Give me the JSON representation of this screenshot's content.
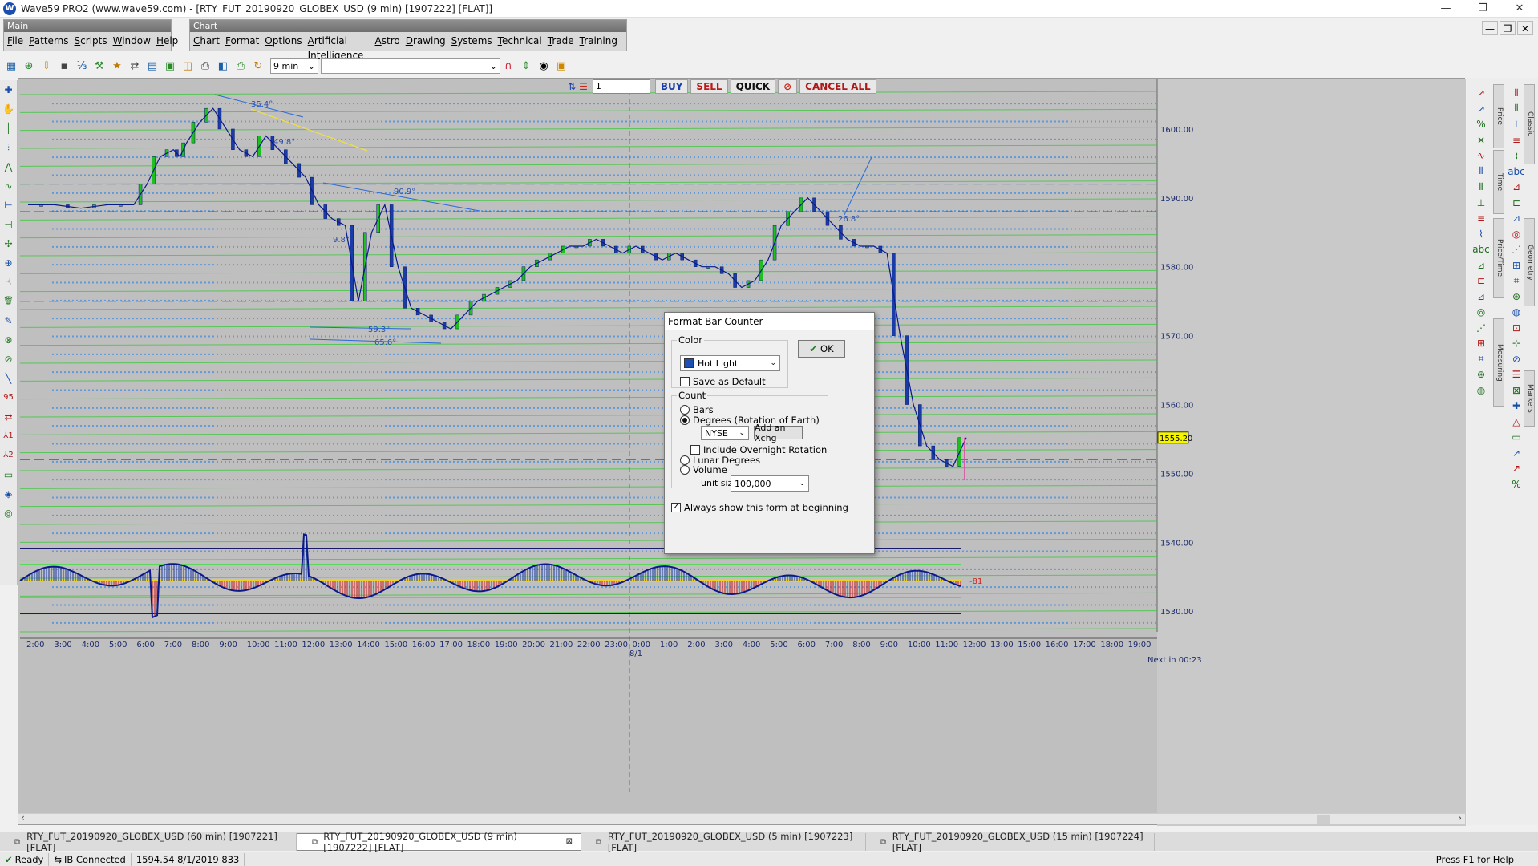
{
  "window": {
    "title": "Wave59 PRO2 (www.wave59.com) - [RTY_FUT_20190920_GLOBEX_USD (9 min) [1907222] [FLAT]]",
    "logo": "W",
    "min": "—",
    "restore": "❐",
    "close": "✕"
  },
  "menus": {
    "main": {
      "label": "Main",
      "items": [
        "File",
        "Patterns",
        "Scripts",
        "Window",
        "Help"
      ]
    },
    "chart": {
      "label": "Chart",
      "items": [
        "Chart",
        "Format",
        "Options",
        "Artificial Intelligence",
        "Astro",
        "Drawing",
        "Systems",
        "Technical",
        "Trade",
        "Training"
      ]
    }
  },
  "toolbar": {
    "interval": "9 min",
    "symbol": "",
    "icons": [
      "chart-open-icon",
      "zoom-icon",
      "import-icon",
      "camera-icon",
      "counter-icon",
      "hammer-icon",
      "star-icon",
      "exchange-icon",
      "folder-icon",
      "save-icon",
      "print-preview-icon",
      "print-icon",
      "scan-icon",
      "printer-icon",
      "refresh-icon"
    ]
  },
  "tradebar": {
    "qty": "1",
    "buy": "BUY",
    "sell": "SELL",
    "quick": "QUICK",
    "cancel_all": "CANCEL ALL"
  },
  "mdi": {
    "min": "—",
    "restore": "❐",
    "close": "✕"
  },
  "chart_data": {
    "type": "line",
    "price_axis": {
      "ticks": [
        "1600.00",
        "1590.00",
        "1580.00",
        "1570.00",
        "1560.00",
        "1550.00",
        "1540.00",
        "1530.00"
      ],
      "ylim": [
        1527,
        1605
      ],
      "current_price": "1555.20"
    },
    "time_axis": {
      "labels": [
        "2:00",
        "3:00",
        "4:00",
        "5:00",
        "6:00",
        "7:00",
        "8:00",
        "9:00",
        "10:00",
        "11:00",
        "12:00",
        "13:00",
        "14:00",
        "15:00",
        "16:00",
        "17:00",
        "18:00",
        "19:00",
        "20:00",
        "21:00",
        "22:00",
        "23:00",
        "0:00",
        "1:00",
        "2:00",
        "3:00",
        "4:00",
        "5:00",
        "6:00",
        "7:00",
        "8:00",
        "9:00",
        "10:00",
        "11:00",
        "12:00",
        "13:00",
        "15:00",
        "16:00",
        "17:00",
        "18:00",
        "19:00"
      ],
      "date_marker": "8/1"
    },
    "price_series": {
      "x": [
        0,
        2,
        4,
        6,
        8,
        9,
        10,
        11,
        11.5,
        12,
        13,
        14,
        15,
        16,
        17,
        18,
        19,
        20,
        21,
        22,
        23,
        24,
        25,
        26,
        27,
        28,
        29,
        30,
        31,
        32,
        33,
        34,
        35,
        36,
        37,
        38,
        39,
        40,
        41,
        42,
        43,
        44,
        45,
        46,
        47,
        48,
        49,
        50,
        51,
        52,
        53,
        54,
        55,
        56,
        57,
        58,
        59,
        60,
        61,
        62,
        63,
        64,
        65,
        66,
        67,
        68,
        69,
        70,
        71
      ],
      "y": [
        1589,
        1589,
        1588.5,
        1589,
        1589,
        1592,
        1596,
        1597,
        1596,
        1598,
        1601,
        1603,
        1600,
        1597,
        1596,
        1599,
        1597,
        1595,
        1593,
        1589,
        1587,
        1586,
        1575,
        1585,
        1589,
        1580,
        1574,
        1573,
        1572,
        1571,
        1573,
        1575,
        1576,
        1577,
        1578,
        1580,
        1581,
        1582,
        1583,
        1583,
        1584,
        1583,
        1582,
        1583,
        1582,
        1581,
        1582,
        1581,
        1580,
        1580,
        1579,
        1577,
        1578,
        1581,
        1586,
        1588,
        1590,
        1588,
        1586,
        1584,
        1583,
        1583,
        1582,
        1570,
        1560,
        1554,
        1552,
        1551,
        1555.2
      ]
    },
    "annotations": [
      "35.4°",
      "49.8°",
      "90.9°",
      "9.8°",
      "59.3°",
      "65.6°",
      "26.8°"
    ],
    "oscillator": {
      "label": "-81"
    },
    "footer_text": "Next in 00:23"
  },
  "dialog": {
    "title": "Format Bar Counter",
    "ok": "OK",
    "color_group": "Color",
    "color_value": "Hot Light",
    "save_default": "Save as Default",
    "count_group": "Count",
    "opt_bars": "Bars",
    "opt_degrees": "Degrees (Rotation of Earth)",
    "exchange": "NYSE",
    "add_xchg": "Add an Xchg",
    "include_overnight": "Include Overnight Rotation",
    "opt_lunar": "Lunar Degrees",
    "opt_volume": "Volume",
    "unit_size_label": "unit size:",
    "unit_size_value": "100,000",
    "always_show": "Always show this form at beginning",
    "swatch_color": "#1e4fb5"
  },
  "left_tools": [
    "✚",
    "✋",
    "│",
    "⫶",
    "⋀",
    "∿",
    "⊢",
    "⊣",
    "✢",
    "⊕",
    "☝",
    "🗑",
    "✎",
    "⊗",
    "⊘",
    "╲",
    "95",
    "⇄",
    "⅄1",
    "⅄2",
    "▭",
    "◈",
    "◎"
  ],
  "right_panel_tabs": [
    "Price",
    "Time",
    "Price/Time",
    "Measuring",
    "Classic",
    "Geometry",
    "Markers"
  ],
  "tabs": [
    {
      "label": "RTY_FUT_20190920_GLOBEX_USD (60 min) [1907221] [FLAT]",
      "active": false
    },
    {
      "label": "RTY_FUT_20190920_GLOBEX_USD (9 min) [1907222] [FLAT]",
      "active": true
    },
    {
      "label": "RTY_FUT_20190920_GLOBEX_USD (5 min) [1907223] [FLAT]",
      "active": false
    },
    {
      "label": "RTY_FUT_20190920_GLOBEX_USD (15 min) [1907224] [FLAT]",
      "active": false
    }
  ],
  "status": {
    "ready": "Ready",
    "ib": "IB Connected",
    "readout": "1594.54  8/1/2019  833",
    "help": "Press F1 for Help"
  }
}
